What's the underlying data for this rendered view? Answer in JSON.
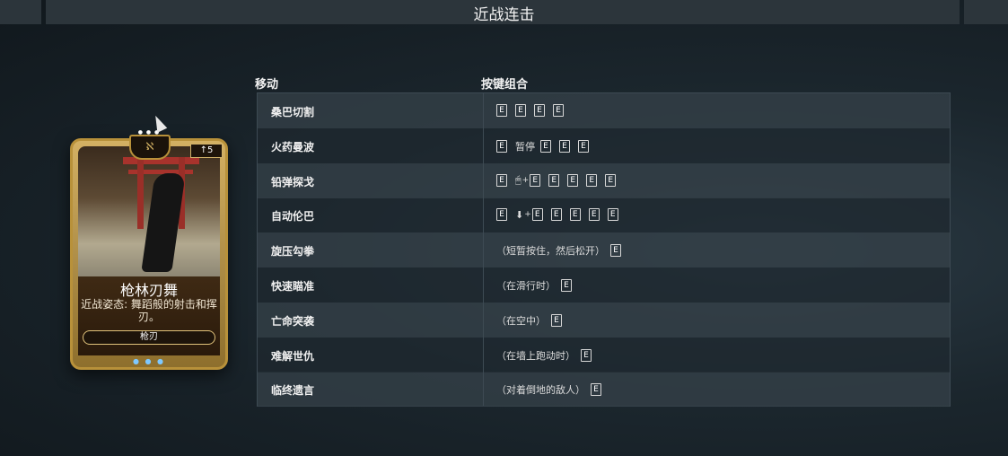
{
  "page_title": "近战连击",
  "card": {
    "name": "枪林刃舞",
    "description": "近战姿态: 舞蹈般的射击和挥刃。",
    "type": "枪刃",
    "drain": "↑5",
    "polarity_symbol": "ℵ",
    "rank_marks": "● ● ●",
    "rank_dots": "● ● ●"
  },
  "headers": {
    "move": "移动",
    "combo": "按键组合"
  },
  "rows": [
    {
      "move": "桑巴切割",
      "combo": [
        {
          "k": "E"
        },
        {
          "k": "E"
        },
        {
          "k": "E"
        },
        {
          "k": "E"
        }
      ]
    },
    {
      "move": "火药曼波",
      "combo": [
        {
          "k": "E"
        },
        {
          "t": "暂停"
        },
        {
          "k": "E"
        },
        {
          "k": "E"
        },
        {
          "k": "E"
        }
      ]
    },
    {
      "move": "铅弹探戈",
      "combo": [
        {
          "k": "E"
        },
        {
          "i": "mouse-icon",
          "g": "🖱",
          "p": "+",
          "k": "E"
        },
        {
          "k": "E"
        },
        {
          "k": "E"
        },
        {
          "k": "E"
        },
        {
          "k": "E"
        }
      ]
    },
    {
      "move": "自动伦巴",
      "combo": [
        {
          "k": "E"
        },
        {
          "i": "down-arrow-icon",
          "g": "⬇",
          "p": "+",
          "k": "E"
        },
        {
          "k": "E"
        },
        {
          "k": "E"
        },
        {
          "k": "E"
        },
        {
          "k": "E"
        }
      ]
    },
    {
      "move": "旋压勾拳",
      "combo": [
        {
          "t": "（短暂按住，然后松开）"
        },
        {
          "k": "E"
        }
      ]
    },
    {
      "move": "快速瞄准",
      "combo": [
        {
          "t": "（在滑行时）"
        },
        {
          "k": "E"
        }
      ]
    },
    {
      "move": "亡命突袭",
      "combo": [
        {
          "t": "（在空中）"
        },
        {
          "k": "E"
        }
      ]
    },
    {
      "move": "难解世仇",
      "combo": [
        {
          "t": "（在墙上跑动时）"
        },
        {
          "k": "E"
        }
      ]
    },
    {
      "move": "临终遗言",
      "combo": [
        {
          "t": "（对着倒地的敌人）"
        },
        {
          "k": "E"
        }
      ]
    }
  ],
  "colors": {
    "gold": "#b8913a",
    "row_light": "#344048",
    "row_dark": "#1e282f"
  }
}
